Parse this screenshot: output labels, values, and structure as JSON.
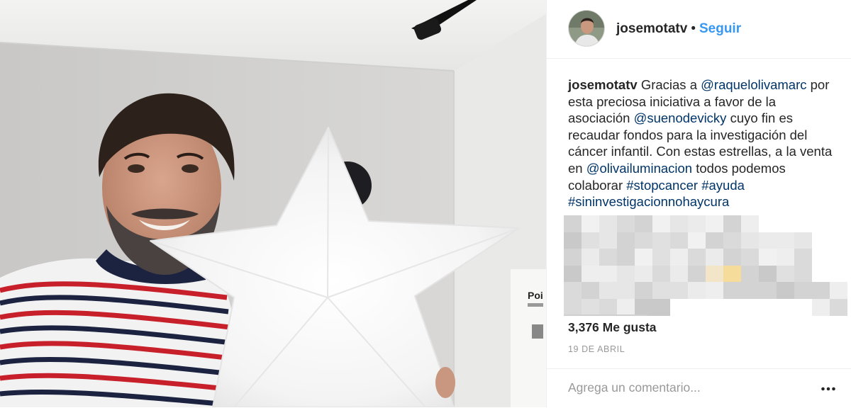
{
  "header": {
    "username": "josemotatv",
    "separator": "•",
    "follow_label": "Seguir"
  },
  "caption": {
    "username": "josemotatv",
    "parts": [
      {
        "type": "text",
        "value": " Gracias a "
      },
      {
        "type": "mention",
        "value": "@raquelolivamarc"
      },
      {
        "type": "text",
        "value": " por esta preciosa iniciativa a favor de la asociación "
      },
      {
        "type": "mention",
        "value": "@suenodevicky"
      },
      {
        "type": "text",
        "value": " cuyo fin es recaudar fondos para la investigación del cáncer infantil. Con estas estrellas, a la venta en "
      },
      {
        "type": "mention",
        "value": "@olivailuminacion"
      },
      {
        "type": "text",
        "value": " todos podemos colaborar "
      },
      {
        "type": "tag",
        "value": "#stopcancer"
      },
      {
        "type": "text",
        "value": " "
      },
      {
        "type": "tag",
        "value": "#ayuda"
      },
      {
        "type": "text",
        "value": " "
      },
      {
        "type": "tag",
        "value": "#sininvestigacionnohaycura"
      }
    ]
  },
  "likes_label": "3,376 Me gusta",
  "date_label": "19 DE ABRIL",
  "comment": {
    "placeholder": "Agrega un comentario..."
  },
  "icons": {
    "more": "more-options-icon"
  },
  "colors": {
    "link": "#003569",
    "follow": "#3897f0",
    "muted": "#999999",
    "text": "#262626"
  }
}
